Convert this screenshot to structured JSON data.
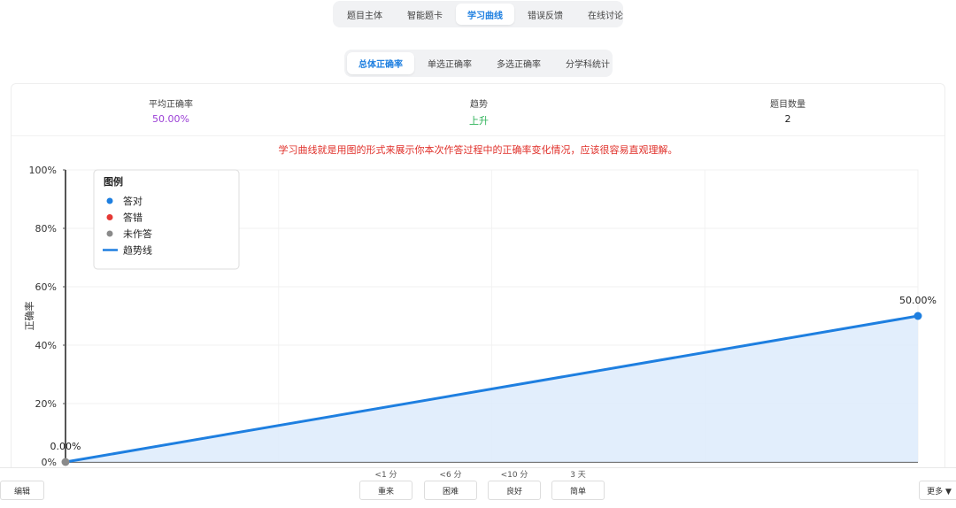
{
  "top_tabs": [
    "题目主体",
    "智能题卡",
    "学习曲线",
    "错误反馈",
    "在线讨论"
  ],
  "top_active": 2,
  "sub_tabs": [
    "总体正确率",
    "单选正确率",
    "多选正确率",
    "分学科统计"
  ],
  "sub_active": 0,
  "stats": {
    "avg_label": "平均正确率",
    "avg_value": "50.00%",
    "trend_label": "趋势",
    "trend_value": "上升",
    "count_label": "题目数量",
    "count_value": "2"
  },
  "note": "学习曲线就是用图的形式来展示你本次作答过程中的正确率变化情况，应该很容易直观理解。",
  "legend": {
    "title": "图例",
    "items": [
      {
        "label": "答对",
        "color": "#1e7fe0",
        "icon": "dot-icon"
      },
      {
        "label": "答错",
        "color": "#e53935",
        "icon": "dot-icon"
      },
      {
        "label": "未作答",
        "color": "#8a8a8a",
        "icon": "dot-icon"
      },
      {
        "label": "趋势线",
        "color": "#1e7fe0",
        "icon": "line-icon"
      }
    ]
  },
  "chart_data": {
    "type": "line",
    "ylabel": "正确率",
    "ylim": [
      0,
      100
    ],
    "yticks": [
      "0%",
      "20%",
      "40%",
      "60%",
      "80%",
      "100%"
    ],
    "grid": true,
    "legend_position": "top-left",
    "series": [
      {
        "x": [
          1,
          2
        ],
        "values": [
          0,
          50
        ],
        "point_labels": [
          "0.00%",
          "50.00%"
        ],
        "point_colors": [
          "#8a8a8a",
          "#1e7fe0"
        ]
      }
    ]
  },
  "bottom": {
    "edit_label": "编辑",
    "more_label": "更多 ▼",
    "rating_buttons": [
      {
        "time": "<1 分",
        "label": "重来"
      },
      {
        "time": "<6 分",
        "label": "困难"
      },
      {
        "time": "<10 分",
        "label": "良好"
      },
      {
        "time": "3 天",
        "label": "简单"
      }
    ]
  }
}
